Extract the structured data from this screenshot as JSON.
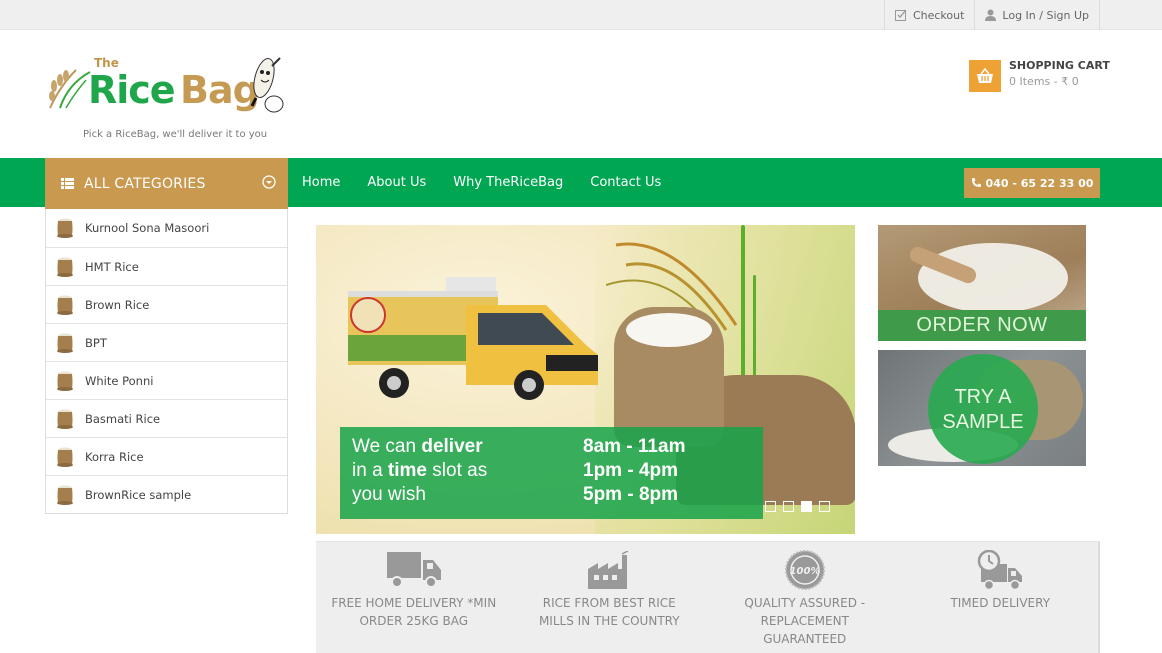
{
  "topbar": {
    "checkout_label": "Checkout",
    "login_label": "Log In / Sign Up"
  },
  "brand": {
    "logo_the": "The",
    "logo_rice": "Rice",
    "logo_bag": "Bag",
    "tagline": "Pick a RiceBag, we'll deliver it to you"
  },
  "cart": {
    "title": "SHOPPING CART",
    "summary": "0 Items - ₹ 0",
    "icon": "basket-icon"
  },
  "nav": {
    "all_categories_label": "ALL CATEGORIES",
    "links": [
      "Home",
      "About Us",
      "Why TheRiceBag",
      "Contact Us"
    ],
    "phone": "040 - 65 22 33 00"
  },
  "categories": [
    "Kurnool Sona Masoori",
    "HMT Rice",
    "Brown Rice",
    "BPT",
    "White Ponni",
    "Basmati Rice",
    "Korra Rice",
    "BrownRice sample"
  ],
  "slider": {
    "line1_pre": "We can ",
    "line1_bold": "deliver",
    "line2_pre": "in a ",
    "line2_bold": "time",
    "line2_post": " slot as",
    "line3": "you wish",
    "slots": [
      "8am - 11am",
      "1pm - 4pm",
      "5pm - 8pm"
    ],
    "slide_count": 4,
    "active_slide": 3
  },
  "promos": {
    "order_now": "ORDER NOW",
    "try_line1": "TRY A",
    "try_line2": "SAMPLE"
  },
  "features": [
    {
      "icon": "truck-icon",
      "line1": "FREE HOME DELIVERY *MIN",
      "line2": "ORDER 25KG BAG",
      "line3": ""
    },
    {
      "icon": "factory-icon",
      "line1": "RICE FROM BEST RICE",
      "line2": "MILLS IN THE COUNTRY",
      "line3": ""
    },
    {
      "icon": "quality-badge-icon",
      "line1": "QUALITY ASSURED -",
      "line2": "REPLACEMENT",
      "line3": "GUARANTEED"
    },
    {
      "icon": "timed-delivery-icon",
      "line1": "TIMED DELIVERY",
      "line2": "",
      "line3": ""
    }
  ],
  "colors": {
    "nav_green": "#00a651",
    "gold": "#c8994f",
    "cart_orange": "#eea236",
    "feature_bg": "#eeeeee"
  }
}
